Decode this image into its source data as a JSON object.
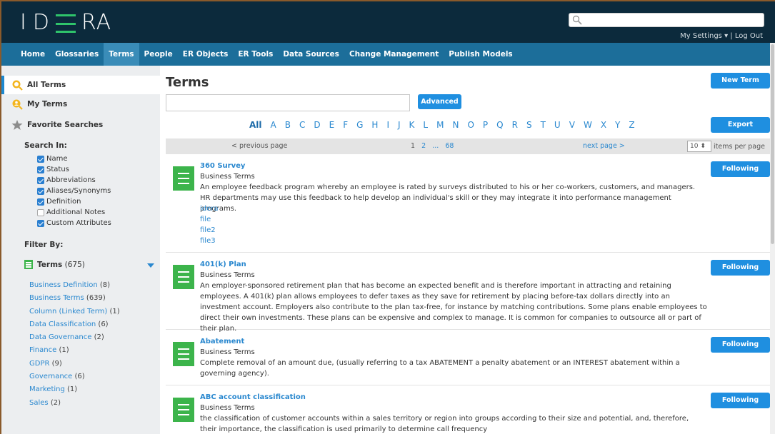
{
  "header": {
    "logo_left": "I",
    "logo_right": "RA",
    "logo_d": "D",
    "search_placeholder": "",
    "top_links": "My Settings ▾ | Log Out"
  },
  "nav": [
    {
      "label": "Home"
    },
    {
      "label": "Glossaries"
    },
    {
      "label": "Terms",
      "active": true
    },
    {
      "label": "People"
    },
    {
      "label": "ER Objects"
    },
    {
      "label": "ER Tools"
    },
    {
      "label": "Data Sources"
    },
    {
      "label": "Change Management"
    },
    {
      "label": "Publish Models"
    }
  ],
  "sidebar": {
    "links": [
      {
        "label": "All Terms",
        "icon": "magnifier-icon"
      },
      {
        "label": "My Terms",
        "icon": "user-magnifier-icon"
      },
      {
        "label": "Favorite Searches",
        "icon": "star-icon"
      }
    ],
    "search_in_label": "Search In:",
    "search_in": [
      {
        "label": "Name",
        "checked": true
      },
      {
        "label": "Status",
        "checked": true
      },
      {
        "label": "Abbreviations",
        "checked": true
      },
      {
        "label": "Aliases/Synonyms",
        "checked": true
      },
      {
        "label": "Definition",
        "checked": true
      },
      {
        "label": "Additional Notes",
        "checked": false
      },
      {
        "label": "Custom Attributes",
        "checked": true
      }
    ],
    "filter_by_label": "Filter By:",
    "terms_label": "Terms",
    "terms_count": "(675)",
    "filters": [
      {
        "label": "Business Definition",
        "count": "(8)"
      },
      {
        "label": "Business Terms",
        "count": "(639)"
      },
      {
        "label": "Column (Linked Term)",
        "count": "(1)"
      },
      {
        "label": "Data Classification",
        "count": "(6)"
      },
      {
        "label": "Data Governance",
        "count": "(2)"
      },
      {
        "label": "Finance",
        "count": "(1)"
      },
      {
        "label": "GDPR",
        "count": "(9)"
      },
      {
        "label": "Governance",
        "count": "(6)"
      },
      {
        "label": "Marketing",
        "count": "(1)"
      },
      {
        "label": "Sales",
        "count": "(2)"
      }
    ]
  },
  "main": {
    "title": "Terms",
    "new_term_label": "New Term",
    "advanced_label": "Advanced",
    "export_label": "Export",
    "alphabet": [
      "All",
      "A",
      "B",
      "C",
      "D",
      "E",
      "F",
      "G",
      "H",
      "I",
      "J",
      "K",
      "L",
      "M",
      "N",
      "O",
      "P",
      "Q",
      "R",
      "S",
      "T",
      "U",
      "V",
      "W",
      "X",
      "Y",
      "Z"
    ],
    "pager": {
      "prev": "< previous page",
      "current": "1",
      "pages": [
        "2",
        "...",
        "68"
      ],
      "next": "next page >",
      "per_page_value": "10",
      "per_page_label": "items per page"
    },
    "follow_label": "Following",
    "rows": [
      {
        "title": "360 Survey",
        "type": "Business Terms",
        "desc": "An employee feedback program whereby an employee is rated by surveys distributed to his or her co-workers, customers, and managers. HR departments may use this feedback to help develop an individual's skill or they may integrate it into performance management programs.",
        "links": [
          "idera",
          "file",
          "file2",
          "file3"
        ]
      },
      {
        "title": "401(k) Plan",
        "type": "Business Terms",
        "desc": "An employer-sponsored retirement plan that has become an expected benefit and is therefore important in attracting and retaining employees. A 401(k) plan allows employees to defer taxes as they save for retirement by placing before-tax dollars directly into an investment account. Employers also contribute to the plan tax-free, for instance by matching contributions. Some plans enable employees to direct their own investments. These plans can be expensive and complex to manage. It is common for companies to outsource all or part of their plan.",
        "links": []
      },
      {
        "title": "Abatement",
        "type": "Business Terms",
        "desc": "Complete removal of an amount due, (usually referring to a tax ABATEMENT a penalty abatement or an INTEREST abatement within a governing agency).",
        "links": []
      },
      {
        "title": "ABC account classification",
        "type": "Business Terms",
        "desc": "the classification of customer accounts within a sales territory or region into groups according to their size and potential, and, therefore, their importance, the classification is used primarily to determine call frequency",
        "links": []
      }
    ]
  }
}
